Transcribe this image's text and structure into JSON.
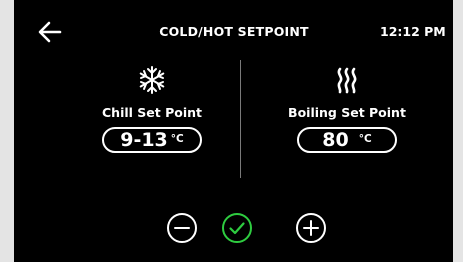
{
  "header": {
    "title": "COLD/HOT SETPOINT",
    "time": "12:12 PM",
    "back_icon": "arrow-left-icon"
  },
  "chill": {
    "icon": "snowflake-icon",
    "label": "Chill Set Point",
    "value": "9-13",
    "unit": "°C"
  },
  "boiling": {
    "icon": "steam-icon",
    "label": "Boiling Set Point",
    "value": "80",
    "unit": "°C"
  },
  "controls": {
    "minus_icon": "minus-circle-icon",
    "confirm_icon": "check-circle-icon",
    "plus_icon": "plus-circle-icon",
    "confirm_color": "#2ecc40"
  },
  "colors": {
    "background": "#000000",
    "foreground": "#ffffff",
    "frame": "#e4e4e4"
  }
}
